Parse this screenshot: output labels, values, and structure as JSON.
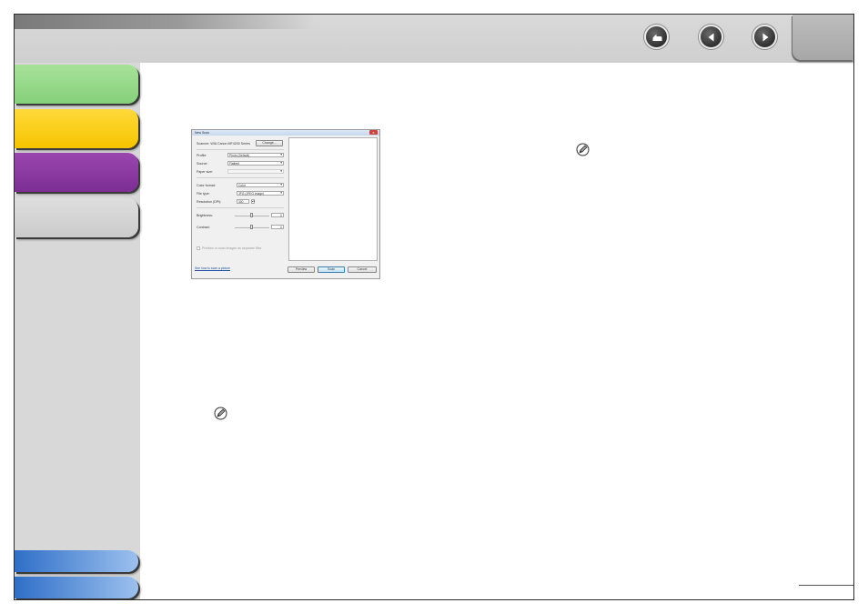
{
  "header": {
    "nav": {
      "back_icon": "return-arrow-icon",
      "prev_icon": "left-triangle-icon",
      "next_icon": "right-triangle-icon"
    }
  },
  "sidebar": {
    "tab_colors": [
      "#8fd683",
      "#f8cc12",
      "#8a3aa2",
      "#d2d2d2",
      "#5a91db",
      "#5a91db"
    ]
  },
  "dialog": {
    "title": "New Scan",
    "close_label": "x",
    "scanner_label": "Scanner: WIA Canon MF4200 Series",
    "change_button": "Change...",
    "profile_label": "Profile:",
    "profile_value": "Photo (Default)",
    "source_label": "Source:",
    "source_value": "Flatbed",
    "paper_size_label": "Paper size:",
    "paper_size_value": "",
    "color_format_label": "Color format:",
    "color_format_value": "Color",
    "file_type_label": "File type:",
    "file_type_value": "JPG (JPEG image)",
    "resolution_label": "Resolution (DPI):",
    "resolution_value": "300",
    "brightness_label": "Brightness:",
    "brightness_value": "0",
    "contrast_label": "Contrast:",
    "contrast_value": "0",
    "preview_checkbox_label": "Preview or scan images as separate files",
    "help_link": "See how to scan a picture",
    "preview_button": "Preview",
    "scan_button": "Scan",
    "cancel_button": "Cancel"
  },
  "notes": {
    "icon": "pencil-note-icon"
  }
}
